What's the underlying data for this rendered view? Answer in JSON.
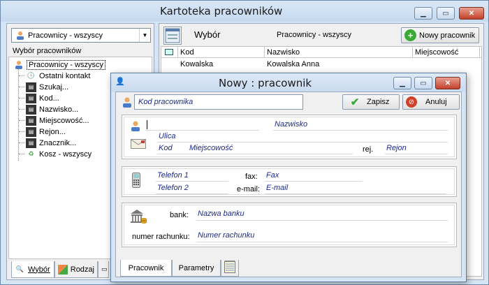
{
  "main": {
    "title": "Kartoteka pracowników",
    "left": {
      "combo_value": "Pracownicy - wszyscy",
      "section_label": "Wybór pracowników",
      "tree_root": "Pracownicy - wszyscy",
      "tree_items": [
        "Ostatni kontakt",
        "Szukaj...",
        "Kod...",
        "Nazwisko...",
        "Miejscowość...",
        "Rejon...",
        "Znacznik...",
        "Kosz - wszyscy"
      ],
      "tabs": [
        "Wybór",
        "Rodzaj"
      ]
    },
    "right": {
      "header_title": "Wybór",
      "header_filter": "Pracownicy - wszyscy",
      "new_button": "Nowy pracownik",
      "columns": [
        "Kod",
        "Nazwisko",
        "Miejscowość"
      ],
      "rows": [
        {
          "kod": "Kowalska",
          "nazwisko": "Kowalska Anna",
          "miejscowosc": ""
        }
      ]
    }
  },
  "dialog": {
    "title": "Nowy : pracownik",
    "code_placeholder": "Kod pracownika",
    "save_button": "Zapisz",
    "cancel_button": "Anuluj",
    "name_block": {
      "nazwisko": "Nazwisko",
      "ulica": "Ulica",
      "kod": "Kod",
      "miejscowosc": "Miejscowość",
      "rej_label": "rej.",
      "rejon": "Rejon"
    },
    "phone_block": {
      "telefon1": "Telefon 1",
      "telefon2": "Telefon 2",
      "fax_label": "fax:",
      "fax": "Fax",
      "email_label": "e-mail:",
      "email": "E-mail"
    },
    "bank_block": {
      "bank_label": "bank:",
      "bank": "Nazwa banku",
      "account_label": "numer rachunku:",
      "account": "Numer rachunku"
    },
    "tabs": [
      "Pracownik",
      "Parametry"
    ]
  },
  "colors": {
    "frame": "#d6e5f5",
    "field_text": "#1a2a8a",
    "accent_green": "#3aa935",
    "accent_red": "#d2402a"
  }
}
